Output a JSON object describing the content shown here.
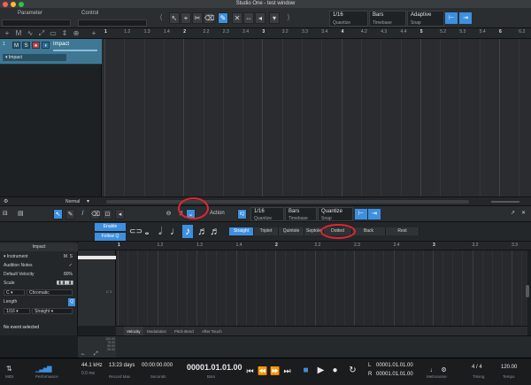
{
  "window": {
    "title": "Studio One - test window"
  },
  "toolbar": {
    "tab_parameter": "Parameter",
    "tab_control": "Control",
    "quantize": {
      "value": "1/16",
      "label": "Quantize"
    },
    "timebase": {
      "value": "Bars",
      "label": "Timebase"
    },
    "snap": {
      "value": "Adaptive",
      "label": "Snap"
    }
  },
  "ruler": {
    "ticks": [
      "1",
      "1.2",
      "1.3",
      "1.4",
      "2",
      "2.2",
      "2.3",
      "2.4",
      "3",
      "3.2",
      "3.3",
      "3.4",
      "4",
      "4.2",
      "4.3",
      "4.4",
      "5",
      "5.2",
      "5.3",
      "5.4",
      "6",
      "6.2"
    ],
    "major": [
      "1",
      "2",
      "3",
      "4",
      "5",
      "6"
    ]
  },
  "track": {
    "number": "1",
    "m": "M",
    "s": "S",
    "name": "Impact",
    "instrument": "Impact"
  },
  "track_bottom": {
    "zoom_mode": "Normal"
  },
  "editor_toolbar": {
    "action_label": "Action",
    "iq": "IQ",
    "quantize": {
      "value": "1/16",
      "label": "Quantize"
    },
    "timebase": {
      "value": "Bars",
      "label": "Timebase"
    },
    "snap": {
      "value": "Quantize",
      "label": "Snap"
    }
  },
  "length_panel": {
    "enable": "Enable",
    "follow_q": "Follow Q",
    "options": [
      "Straight",
      "Triplet",
      "Quintole",
      "Septole",
      "Dotted",
      "Back",
      "Rest"
    ]
  },
  "inspector": {
    "title": "Impact",
    "instrument_label": "Instrument",
    "m": "M",
    "s": "S",
    "audition_notes": "Audition Notes",
    "default_velocity": "Default Velocity",
    "default_velocity_value": "80%",
    "scale": "Scale",
    "scale_root": "C",
    "scale_mode": "Chromatic",
    "length": "Length",
    "length_value": "1/16",
    "length_type": "Straight",
    "no_event": "No event selected"
  },
  "piano_ruler": {
    "ticks": [
      "1",
      "1.2",
      "1.3",
      "1.4",
      "2",
      "2.2",
      "2.3",
      "2.4",
      "3",
      "3.2",
      "3.3"
    ],
    "major": [
      "1",
      "2",
      "3"
    ]
  },
  "piano": {
    "c3_label": "C 3"
  },
  "lanes": [
    "Velocity",
    "Modulation",
    "Pitch Bend",
    "After Touch"
  ],
  "velocity_scale": [
    "100.00",
    "75.00",
    "50.00",
    "25.00"
  ],
  "transport": {
    "midi": "MIDI",
    "performance": "Performance",
    "sample_rate": "44.1 kHz",
    "latency": "0.0 ms",
    "record_max": "13:23 days",
    "record_max_label": "Record Max",
    "seconds": "00:00:00.000",
    "seconds_label": "Seconds",
    "position": "00001.01.01.00",
    "position_label": "Bars",
    "loop_l": "00001.01.01.00",
    "loop_r": "00001.01.01.00",
    "l": "L",
    "r": "R",
    "metronome_label": "Metronome",
    "timing": "4 / 4",
    "timing_label": "Timing",
    "tempo": "120.00",
    "tempo_label": "Tempo"
  },
  "colors": {
    "accent": "#3d8fe0",
    "track": "#3e7895",
    "annotation": "#e2262d"
  }
}
